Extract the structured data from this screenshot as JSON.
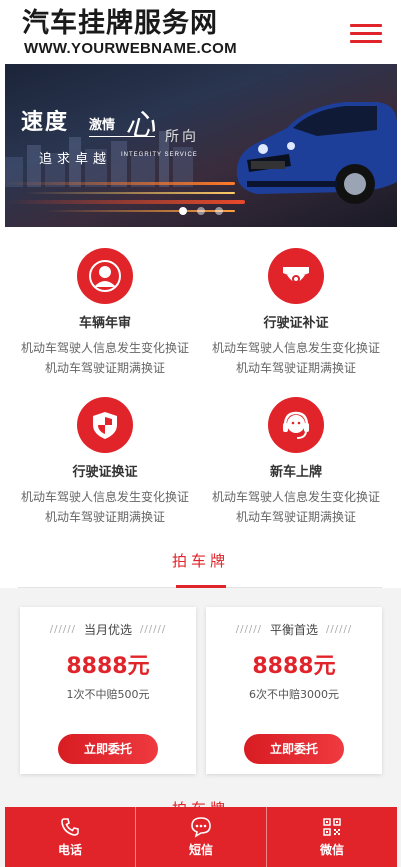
{
  "header": {
    "title": "汽车挂牌服务网",
    "domain": "WWW.YOURWEBNAME.COM",
    "menu_icon": "hamburger-menu-icon"
  },
  "banner": {
    "title_main": "速度",
    "title_passion": "激情",
    "title_heart": "心",
    "title_direction": "所向",
    "subtitle": "追求卓越",
    "subtitle_en": "INTEGRITY SERVICE",
    "slides": 3,
    "active_slide": 1
  },
  "services": [
    {
      "title": "车辆年审",
      "line1": "机动车驾驶人信息发生变化换证",
      "line2": "机动车驾驶证期满换证",
      "icon": "user-icon"
    },
    {
      "title": "行驶证补证",
      "line1": "机动车驾驶人信息发生变化换证",
      "line2": "机动车驾驶证期满换证",
      "icon": "camera-icon"
    },
    {
      "title": "行驶证换证",
      "line1": "机动车驾驶人信息发生变化换证",
      "line2": "机动车驾驶证期满换证",
      "icon": "shield-icon"
    },
    {
      "title": "新车上牌",
      "line1": "机动车驾驶人信息发生变化换证",
      "line2": "机动车驾驶证期满换证",
      "icon": "headset-icon"
    }
  ],
  "section": {
    "title": "拍车牌",
    "title_next": "拍车牌"
  },
  "plans": [
    {
      "deco": "//////",
      "name": "当月优选",
      "price": "8888元",
      "note": "1次不中赔500元",
      "button": "立即委托"
    },
    {
      "deco": "//////",
      "name": "平衡首选",
      "price": "8888元",
      "note": "6次不中赔3000元",
      "button": "立即委托"
    }
  ],
  "bottom_nav": [
    {
      "label": "电话",
      "icon": "phone-icon"
    },
    {
      "label": "短信",
      "icon": "message-icon"
    },
    {
      "label": "微信",
      "icon": "qrcode-icon"
    }
  ],
  "colors": {
    "accent": "#e0242a",
    "text": "#333333",
    "muted": "#666666"
  }
}
